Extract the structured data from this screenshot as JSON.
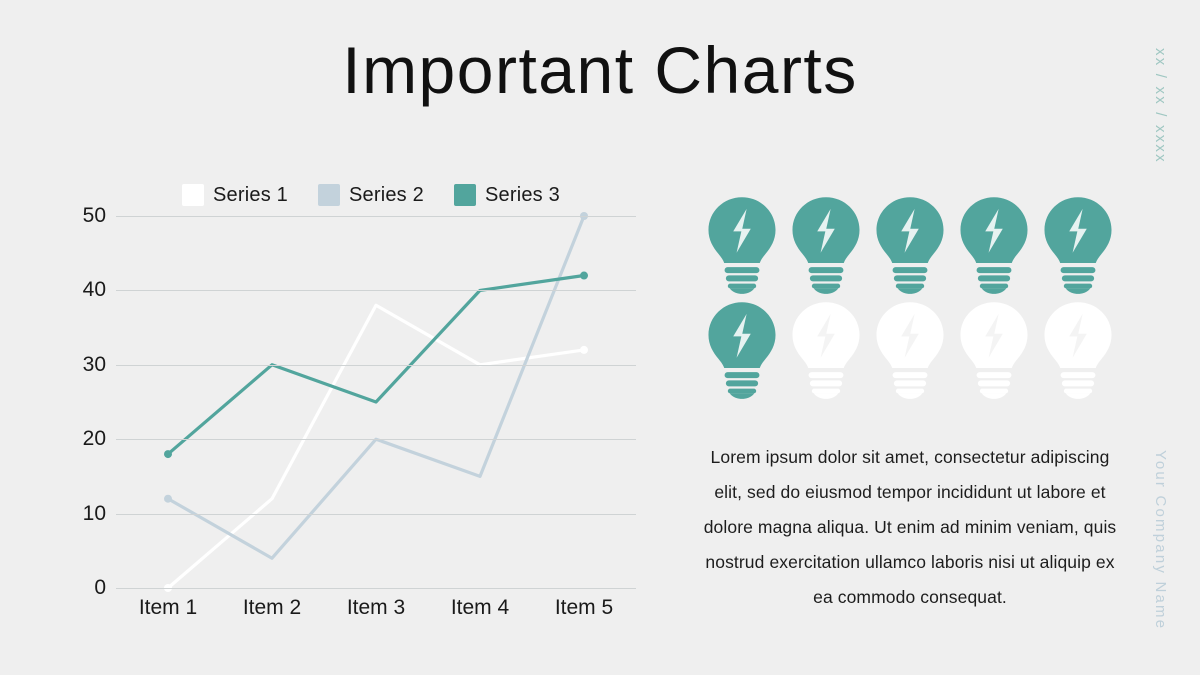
{
  "slide": {
    "title": "Important Charts",
    "background_color": "#efefef",
    "date_vertical": "xx / xx / xxxx",
    "company_vertical": "Your Company Name",
    "body_text": "Lorem ipsum dolor sit amet, consectetur adipiscing elit, sed do eiusmod tempor incididunt ut labore et dolore magna aliqua. Ut enim ad minim veniam, quis nostrud exercitation ullamco laboris nisi ut aliquip ex ea commodo consequat."
  },
  "colors": {
    "teal": "#52a59d",
    "pale_blue": "#c3d2dc",
    "white": "#ffffff",
    "grid": "#cfd3d4",
    "text": "#1a1a1a",
    "date_text": "#9fc7c2",
    "company_text": "#bfd0da"
  },
  "infographic": {
    "name": "lightbulb-ratio",
    "icon": "lightbulb-icon",
    "total": 10,
    "filled": 6,
    "columns": 5,
    "rows": 2,
    "bulbs": [
      {
        "index": 1,
        "state": "filled",
        "color": "#52a59d"
      },
      {
        "index": 2,
        "state": "filled",
        "color": "#52a59d"
      },
      {
        "index": 3,
        "state": "filled",
        "color": "#52a59d"
      },
      {
        "index": 4,
        "state": "filled",
        "color": "#52a59d"
      },
      {
        "index": 5,
        "state": "filled",
        "color": "#52a59d"
      },
      {
        "index": 6,
        "state": "filled",
        "color": "#52a59d"
      },
      {
        "index": 7,
        "state": "empty",
        "color": "#ffffff"
      },
      {
        "index": 8,
        "state": "empty",
        "color": "#ffffff"
      },
      {
        "index": 9,
        "state": "empty",
        "color": "#ffffff"
      },
      {
        "index": 10,
        "state": "empty",
        "color": "#ffffff"
      }
    ]
  },
  "chart_data": {
    "type": "line",
    "title": "",
    "xlabel": "",
    "ylabel": "",
    "categories": [
      "Item 1",
      "Item 2",
      "Item 3",
      "Item 4",
      "Item 5"
    ],
    "yticks": [
      0,
      10,
      20,
      30,
      40,
      50
    ],
    "ylim": [
      0,
      50
    ],
    "grid": true,
    "legend_position": "top",
    "series": [
      {
        "name": "Series 1",
        "color": "#ffffff",
        "values": [
          0,
          12,
          38,
          30,
          32
        ]
      },
      {
        "name": "Series 2",
        "color": "#c3d2dc",
        "values": [
          12,
          4,
          20,
          15,
          50
        ]
      },
      {
        "name": "Series 3",
        "color": "#52a59d",
        "values": [
          18,
          30,
          25,
          40,
          42
        ]
      }
    ]
  }
}
